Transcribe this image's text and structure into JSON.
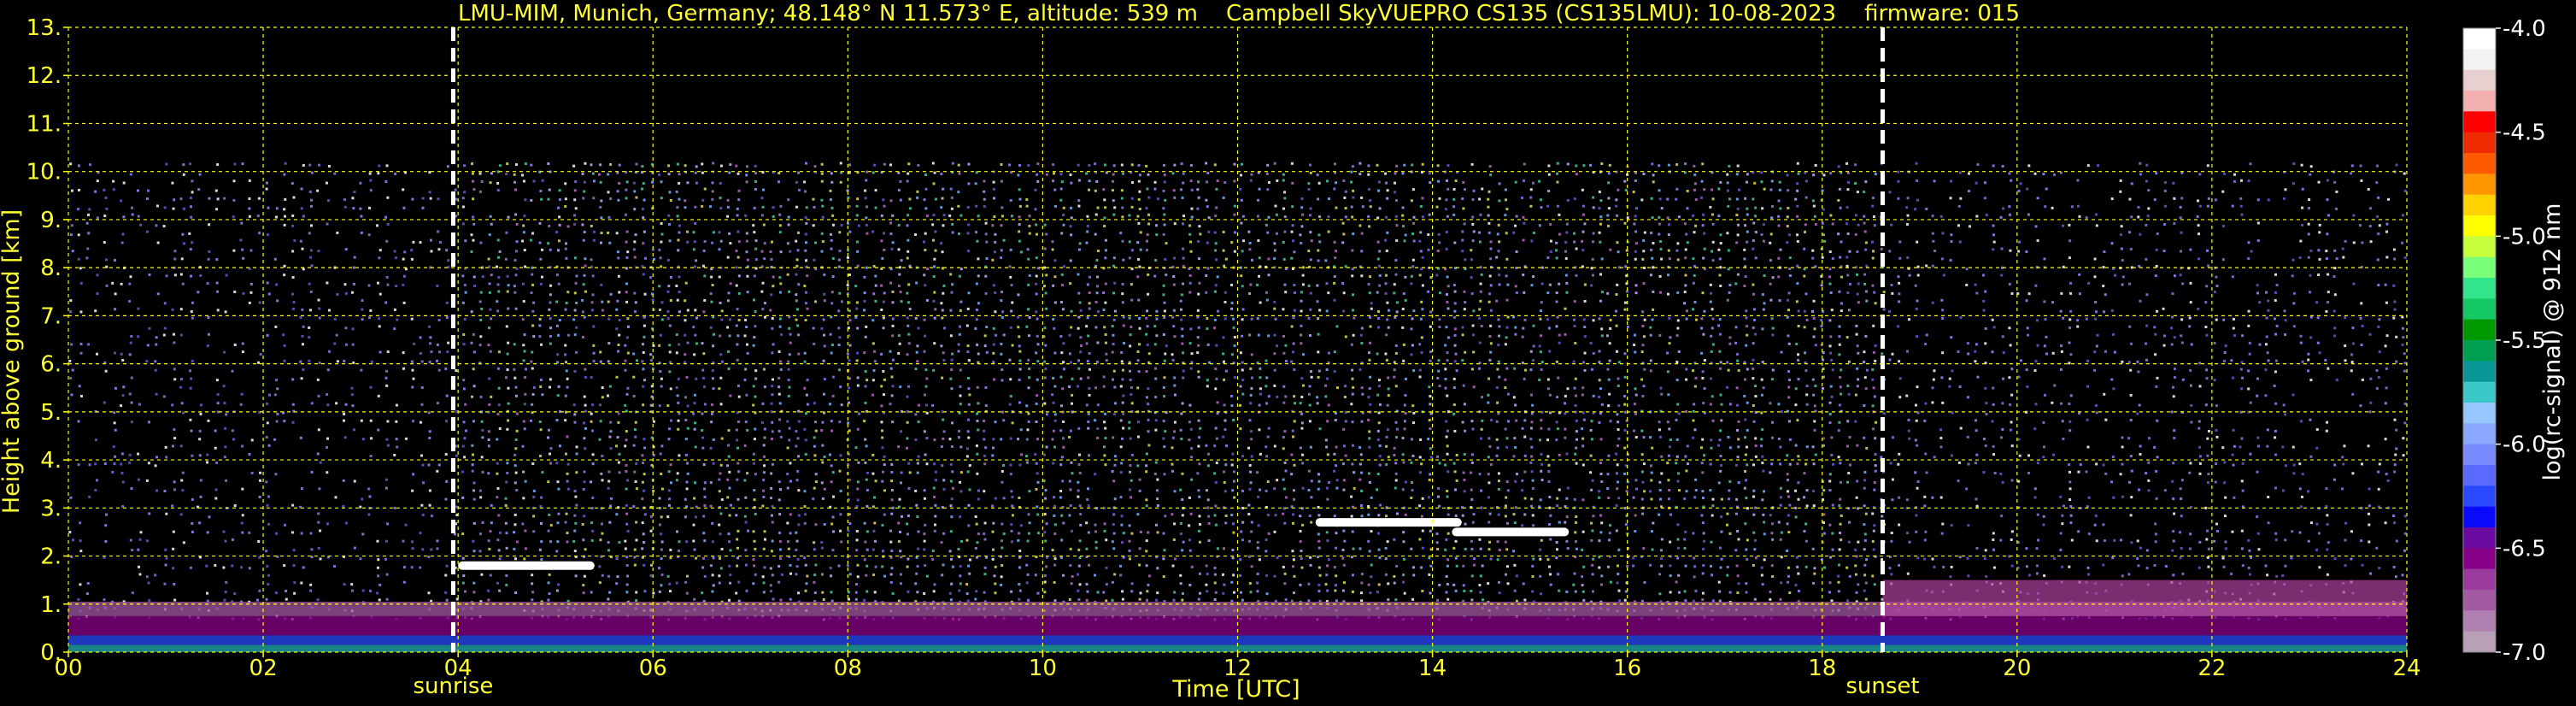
{
  "chart_data": {
    "type": "heatmap",
    "title": "LMU-MIM, Munich, Germany; 48.148° N 11.573° E, altitude: 539 m    Campbell SkyVUEPRO CS135 (CS135LMU): 10-08-2023    firmware: 015",
    "xlabel": "Time [UTC]",
    "ylabel": "Height above ground [km]",
    "xlim": [
      0,
      24
    ],
    "ylim": [
      0,
      13
    ],
    "x_ticks": [
      "00",
      "02",
      "04",
      "06",
      "08",
      "10",
      "12",
      "14",
      "16",
      "18",
      "20",
      "22",
      "24"
    ],
    "y_ticks": [
      "0.",
      "1.",
      "2.",
      "3.",
      "4.",
      "5.",
      "6.",
      "7.",
      "8.",
      "9.",
      "10.",
      "11.",
      "12.",
      "13."
    ],
    "grid": true,
    "signal_top_km": 10.2,
    "markers": [
      {
        "label": "sunrise",
        "x": 3.95
      },
      {
        "label": "sunset",
        "x": 18.62
      }
    ],
    "cloud_layers": [
      {
        "x0": 12.8,
        "x1": 14.3,
        "y": 2.7
      },
      {
        "x0": 14.2,
        "x1": 15.4,
        "y": 2.5
      },
      {
        "x0": 4.0,
        "x1": 5.4,
        "y": 1.8
      }
    ],
    "colorbar": {
      "label": "log(rc-signal) @ 912 nm",
      "range": [
        -7.0,
        -4.0
      ],
      "ticks": [
        "-4.0",
        "-4.5",
        "-5.0",
        "-5.5",
        "-6.0",
        "-6.5",
        "-7.0"
      ],
      "colors": [
        "#ffffff",
        "#f2f2f2",
        "#e6d0d0",
        "#f2b0b0",
        "#ff0000",
        "#ee2a00",
        "#ff5a00",
        "#ff9600",
        "#ffd200",
        "#ffff00",
        "#c8ff3c",
        "#7aff7a",
        "#32e68c",
        "#14c864",
        "#009a00",
        "#00a050",
        "#0a9696",
        "#3cc8c8",
        "#96c8ff",
        "#8aa8ff",
        "#7a8aff",
        "#5a6aff",
        "#2a4aff",
        "#0a0aff",
        "#6a0aa0",
        "#880088",
        "#9a3a9a",
        "#a25aa2",
        "#b080b0",
        "#b8a0b8"
      ]
    }
  }
}
